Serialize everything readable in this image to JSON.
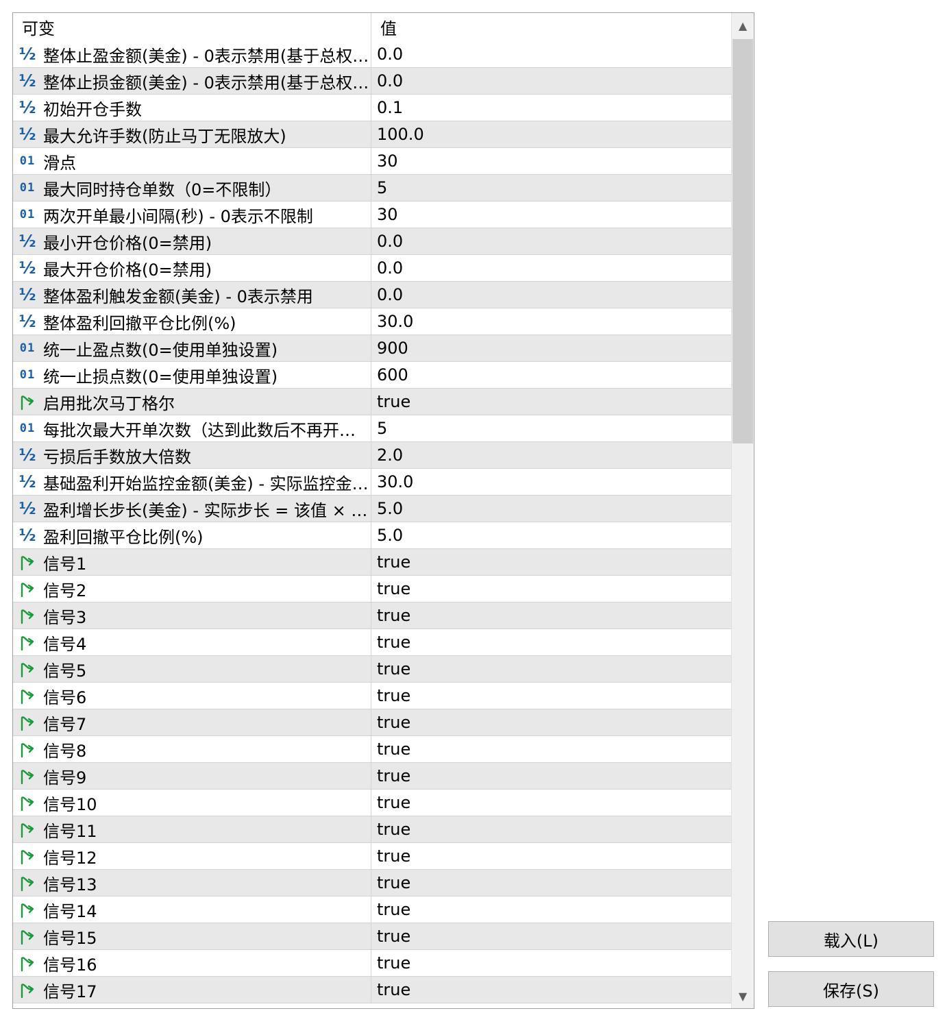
{
  "header": {
    "name_col": "可变",
    "value_col": "值"
  },
  "rows": [
    {
      "icon": "half",
      "name": "整体止盈金额(美金) - 0表示禁用(基于总权…",
      "value": "0.0"
    },
    {
      "icon": "half",
      "name": "整体止损金额(美金) - 0表示禁用(基于总权…",
      "value": "0.0"
    },
    {
      "icon": "half",
      "name": "初始开仓手数",
      "value": "0.1"
    },
    {
      "icon": "half",
      "name": "最大允许手数(防止马丁无限放大)",
      "value": "100.0"
    },
    {
      "icon": "int",
      "name": "滑点",
      "value": "30"
    },
    {
      "icon": "int",
      "name": "最大同时持仓单数（0=不限制）",
      "value": "5"
    },
    {
      "icon": "int",
      "name": "两次开单最小间隔(秒) - 0表示不限制",
      "value": "30"
    },
    {
      "icon": "half",
      "name": "最小开仓价格(0=禁用)",
      "value": "0.0"
    },
    {
      "icon": "half",
      "name": "最大开仓价格(0=禁用)",
      "value": "0.0"
    },
    {
      "icon": "half",
      "name": "整体盈利触发金额(美金) - 0表示禁用",
      "value": "0.0"
    },
    {
      "icon": "half",
      "name": "整体盈利回撤平仓比例(%)",
      "value": "30.0"
    },
    {
      "icon": "int",
      "name": "统一止盈点数(0=使用单独设置)",
      "value": "900"
    },
    {
      "icon": "int",
      "name": "统一止损点数(0=使用单独设置)",
      "value": "600"
    },
    {
      "icon": "bool",
      "name": "启用批次马丁格尔",
      "value": "true"
    },
    {
      "icon": "int",
      "name": "每批次最大开单次数（达到此数后不再开…",
      "value": "5"
    },
    {
      "icon": "half",
      "name": "亏损后手数放大倍数",
      "value": "2.0"
    },
    {
      "icon": "half",
      "name": "基础盈利开始监控金额(美金) - 实际监控金…",
      "value": "30.0"
    },
    {
      "icon": "half",
      "name": "盈利增长步长(美金) - 实际步长 = 该值 × …",
      "value": "5.0"
    },
    {
      "icon": "half",
      "name": "盈利回撤平仓比例(%)",
      "value": "5.0"
    },
    {
      "icon": "bool",
      "name": "信号1",
      "value": "true"
    },
    {
      "icon": "bool",
      "name": "信号2",
      "value": "true"
    },
    {
      "icon": "bool",
      "name": "信号3",
      "value": "true"
    },
    {
      "icon": "bool",
      "name": "信号4",
      "value": "true"
    },
    {
      "icon": "bool",
      "name": "信号5",
      "value": "true"
    },
    {
      "icon": "bool",
      "name": "信号6",
      "value": "true"
    },
    {
      "icon": "bool",
      "name": "信号7",
      "value": "true"
    },
    {
      "icon": "bool",
      "name": "信号8",
      "value": "true"
    },
    {
      "icon": "bool",
      "name": "信号9",
      "value": "true"
    },
    {
      "icon": "bool",
      "name": "信号10",
      "value": "true"
    },
    {
      "icon": "bool",
      "name": "信号11",
      "value": "true"
    },
    {
      "icon": "bool",
      "name": "信号12",
      "value": "true"
    },
    {
      "icon": "bool",
      "name": "信号13",
      "value": "true"
    },
    {
      "icon": "bool",
      "name": "信号14",
      "value": "true"
    },
    {
      "icon": "bool",
      "name": "信号15",
      "value": "true"
    },
    {
      "icon": "bool",
      "name": "信号16",
      "value": "true"
    },
    {
      "icon": "bool",
      "name": "信号17",
      "value": "true"
    }
  ],
  "icons": {
    "half": "½",
    "int": "01"
  },
  "buttons": {
    "load": "载入(L)",
    "save": "保存(S)"
  },
  "colors": {
    "icon_blue": "#1a5fa6",
    "icon_green": "#1a9a3a",
    "row_alt": "#e8e8e8"
  }
}
